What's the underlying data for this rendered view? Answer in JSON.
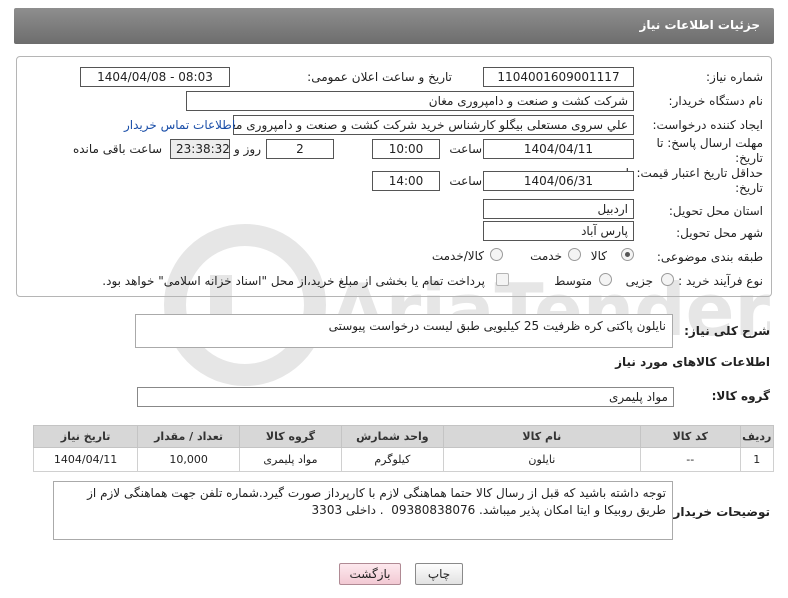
{
  "header": {
    "title": "جزئیات اطلاعات نیاز"
  },
  "form": {
    "need_number": {
      "label": "شماره نیاز:",
      "value": "1104001609001117"
    },
    "announce_datetime": {
      "label": "تاریخ و ساعت اعلان عمومی:",
      "value": "1404/04/08 - 08:03"
    },
    "buyer_org": {
      "label": "نام دستگاه خریدار:",
      "value": "شرکت کشت و صنعت و دامپروری مغان"
    },
    "creator": {
      "label": "ایجاد کننده درخواست:",
      "value": "علي سروی مستعلی بیگلو کارشناس خرید شرکت کشت و صنعت و دامپروری مغان",
      "contact_link": "اطلاعات تماس خریدار"
    },
    "reply_deadline": {
      "label": "مهلت ارسال پاسخ: تا تاریخ:",
      "date": "1404/04/11",
      "time_label": "ساعت",
      "time": "10:00",
      "days": "2",
      "days_label": "روز و",
      "remaining": "23:38:32",
      "remaining_label": "ساعت باقی مانده"
    },
    "price_validity": {
      "label": "حداقل تاریخ اعتبار قیمت: تا تاریخ:",
      "date": "1404/06/31",
      "time_label": "ساعت",
      "time": "14:00"
    },
    "delivery_province": {
      "label": "استان محل تحویل:",
      "value": "اردبیل"
    },
    "delivery_city": {
      "label": "شهر محل تحویل:",
      "value": "پارس آباد"
    },
    "category": {
      "label": "طبقه بندی موضوعی:",
      "options": [
        "کالا",
        "خدمت",
        "کالا/خدمت"
      ],
      "selected": "کالا"
    },
    "purchase_process": {
      "label": "نوع فرآیند خرید :",
      "options": [
        "جزیی",
        "متوسط"
      ],
      "selected": "",
      "payment_note": "پرداخت تمام یا بخشی از مبلغ خرید،از محل \"اسناد خزانه اسلامی\" خواهد بود."
    }
  },
  "description": {
    "label": "شرح کلی نیاز:",
    "value": "نایلون پاکتی کره ظرفیت 25 کیلیویی طبق لیست درخواست پیوستی"
  },
  "goods_info": {
    "section_title": "اطلاعات کالاهای مورد نیاز",
    "group_label": "گروه کالا:",
    "group_value": "مواد پلیمری"
  },
  "goods_table": {
    "columns": [
      "ردیف",
      "کد کالا",
      "نام کالا",
      "واحد شمارش",
      "گروه کالا",
      "تعداد / مقدار",
      "تاریخ نیاز"
    ],
    "rows": [
      [
        "1",
        "--",
        "نایلون",
        "کیلوگرم",
        "مواد پلیمری",
        "10,000",
        "1404/04/11"
      ]
    ]
  },
  "buyer_notes": {
    "label": "توضیحات خریدار:",
    "value": "توجه داشته باشید که قبل از رسال کالا حتما هماهنگی لازم با کارپرداز صورت گیرد.شماره تلفن جهت هماهنگی لازم از طریق روبیکا و ایتا امکان پذیر میباشد. 09380838076  . داخلی 3303"
  },
  "buttons": {
    "print": "چاپ",
    "back": "بازگشت"
  },
  "watermark_text": "AriaTender.neT",
  "colors": {
    "header_bg": "#7d7d7d",
    "link": "#1a4ea8",
    "back_button": "#f2c9d3",
    "watermark": "#e2e2e2"
  }
}
